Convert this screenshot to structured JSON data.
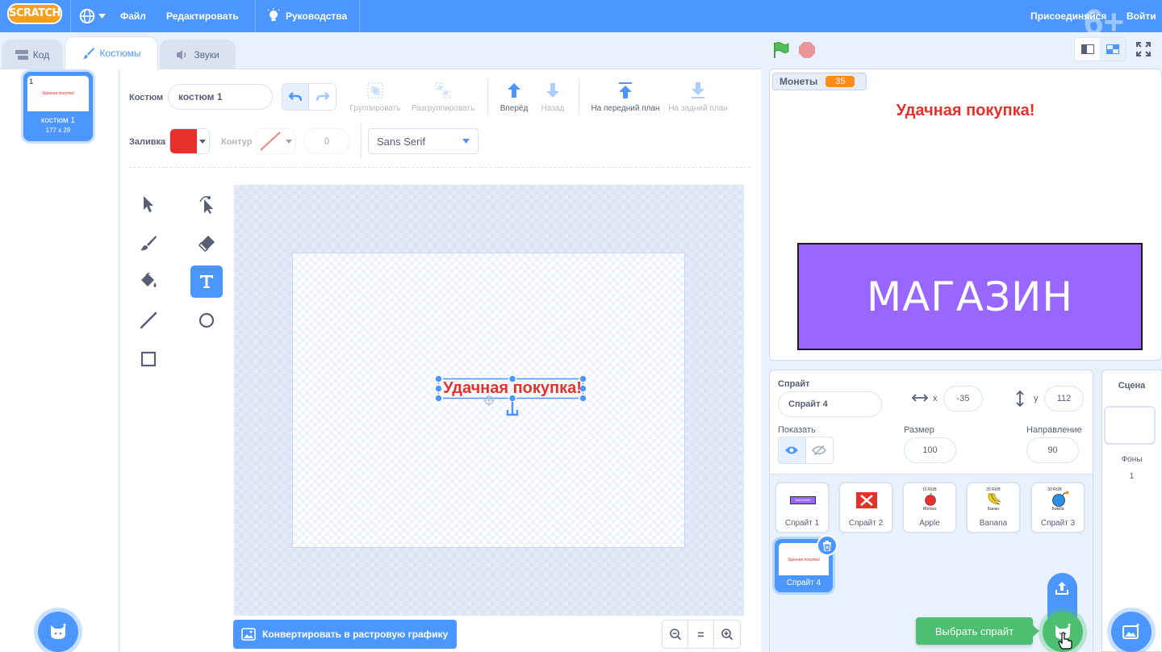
{
  "menubar": {
    "logo": "SCRATCH",
    "file": "Файл",
    "edit": "Редактировать",
    "tutorials": "Руководства",
    "join": "Присоединяйся",
    "signin": "Войти",
    "age_badge": "6+"
  },
  "tabs": {
    "code": "Код",
    "costumes": "Костюмы",
    "sounds": "Звуки"
  },
  "costume_list": [
    {
      "index": "1",
      "name": "костюм 1",
      "size": "177 x 28",
      "preview_text": "Удачная покупка!"
    }
  ],
  "toolbar": {
    "costume_label": "Костюм",
    "costume_name": "костюм 1",
    "group": "Группировать",
    "ungroup": "Разгруппировать",
    "forward": "Вперёд",
    "backward": "Назад",
    "front": "На передний план",
    "back": "На задний план",
    "fill_label": "Заливка",
    "outline_label": "Контур",
    "outline_width": "0",
    "font": "Sans Serif",
    "fill_color": "#e8302b"
  },
  "canvas": {
    "text": "Удачная покупка!"
  },
  "bottom": {
    "convert": "Конвертировать в растровую графику",
    "zoom_reset": "="
  },
  "stage": {
    "monitor_label": "Монеты",
    "monitor_value": "35",
    "message": "Удачная покупка!",
    "shop_label": "МАГАЗИН"
  },
  "sprite_info": {
    "sprite_label": "Спрайт",
    "sprite_name": "Спрайт 4",
    "x_label": "x",
    "x_value": "-35",
    "y_label": "y",
    "y_value": "112",
    "show_label": "Показать",
    "size_label": "Размер",
    "size_value": "100",
    "direction_label": "Направление",
    "direction_value": "90"
  },
  "sprites": [
    {
      "name": "Спрайт 1",
      "thumb": "МАГАЗИН"
    },
    {
      "name": "Спрайт 2",
      "thumb": ""
    },
    {
      "name": "Apple",
      "price": "15 RUB",
      "label": "Яблоко"
    },
    {
      "name": "Banana",
      "price": "20 RUB",
      "label": "Банан"
    },
    {
      "name": "Спрайт 3",
      "price": "30 RUB",
      "label": "Бомба"
    },
    {
      "name": "Спрайт 4",
      "thumb": "Удачная покупка!"
    }
  ],
  "choose_sprite_tooltip": "Выбрать спрайт",
  "scene": {
    "title": "Сцена",
    "backdrops_label": "Фоны",
    "backdrops_count": "1"
  }
}
